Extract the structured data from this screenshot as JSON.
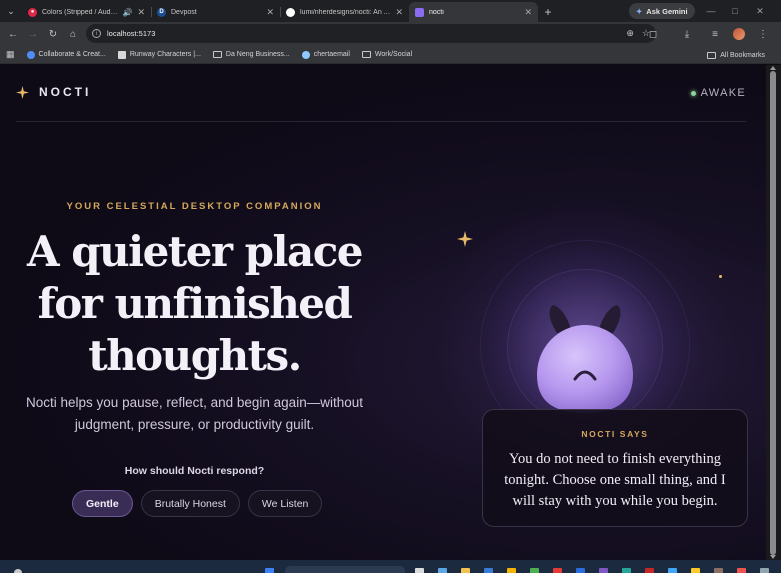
{
  "browser": {
    "tabs": [
      {
        "title": "Colors (Stripped / Audio) |",
        "favicon_color": "#e0284b",
        "audio": true,
        "active": false
      },
      {
        "title": "Devpost",
        "favicon_letter": "D",
        "favicon_color": "#1b4f91",
        "active": false
      },
      {
        "title": "lumi/nherdesigns/nocti: An AI c",
        "favicon_color": "#ffffff",
        "active": false
      },
      {
        "title": "nocti",
        "favicon_color": "#8a6cf0",
        "active": true
      }
    ],
    "gemini_label": "Ask Gemini",
    "url": "localhost:5173",
    "bookmarks": [
      {
        "label": "Collaborate & Creat...",
        "type": "site",
        "color": "#4f8cf6"
      },
      {
        "label": "Runway Characters |...",
        "type": "site",
        "color": "#d8d8d8"
      },
      {
        "label": "Da Neng Business...",
        "type": "folder"
      },
      {
        "label": "chertaemail",
        "type": "site",
        "color": "#8fc7ff"
      },
      {
        "label": "Work/Social",
        "type": "folder"
      }
    ],
    "all_bookmarks_label": "All Bookmarks"
  },
  "app": {
    "brand": "NOCTI",
    "status": "AWAKE",
    "eyebrow": "YOUR CELESTIAL DESKTOP COMPANION",
    "headline": [
      "A quieter place",
      "for unfinished",
      "thoughts."
    ],
    "subtitle": [
      "Nocti helps you pause, reflect, and begin again—without",
      "judgment, pressure, or productivity guilt."
    ],
    "question": "How should Nocti respond?",
    "modes": [
      {
        "label": "Gentle",
        "active": true
      },
      {
        "label": "Brutally Honest",
        "active": false
      },
      {
        "label": "We Listen",
        "active": false
      }
    ],
    "card": {
      "label": "NOCTI SAYS",
      "message": "You do not need to finish everything tonight. Choose one small thing, and I will stay with you while you begin."
    }
  },
  "colors": {
    "accent_gold": "#d6a85c",
    "creature_purple": "#b697ee",
    "status_green": "#8fd19b",
    "page_bg": "#0e0a16"
  }
}
